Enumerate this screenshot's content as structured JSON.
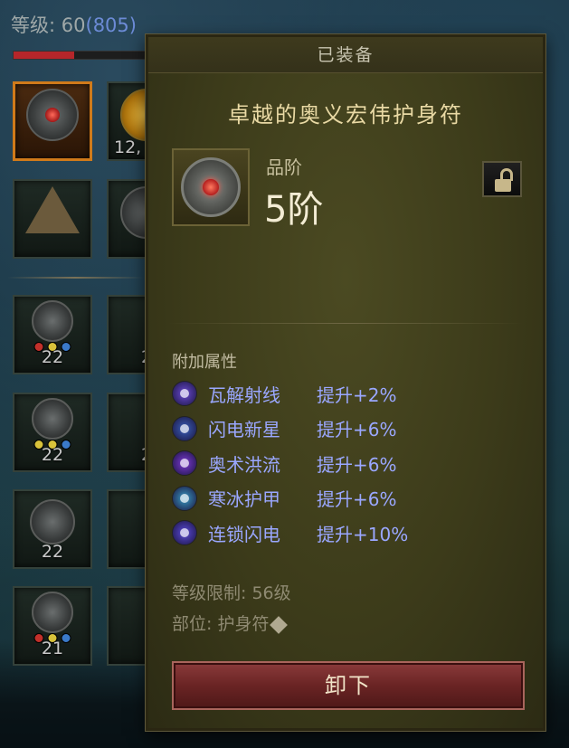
{
  "hud": {
    "level_label": "等级: ",
    "level_value": "60",
    "paragon_value": "(805)",
    "xp_fraction": 0.45
  },
  "inventory": {
    "slots": [
      {
        "count": ""
      },
      {
        "count": "12,"
      },
      {
        "count": ""
      },
      {
        "count": ""
      },
      {
        "count": "22"
      },
      {
        "count": "2"
      },
      {
        "count": "22"
      },
      {
        "count": "2"
      },
      {
        "count": "22"
      },
      {
        "count": ""
      },
      {
        "count": "21"
      },
      {
        "count": ""
      }
    ]
  },
  "tooltip": {
    "header": "已装备",
    "item_name": "卓越的奥义宏伟护身符",
    "grade_label": "品阶",
    "grade_value": "5阶",
    "attributes_title": "附加属性",
    "attributes": [
      {
        "skill": "瓦解射线",
        "bonus": "提升+2%",
        "icon": "disintegrate-icon",
        "color": "#6a4bd2"
      },
      {
        "skill": "闪电新星",
        "bonus": "提升+6%",
        "icon": "lightning-nova-icon",
        "color": "#3a5fb8"
      },
      {
        "skill": "奥术洪流",
        "bonus": "提升+6%",
        "icon": "arcane-torrent-icon",
        "color": "#7b3ad2"
      },
      {
        "skill": "寒冰护甲",
        "bonus": "提升+6%",
        "icon": "ice-armor-icon",
        "color": "#3a9ac2"
      },
      {
        "skill": "连锁闪电",
        "bonus": "提升+10%",
        "icon": "chain-lightning-icon",
        "color": "#5a4ad6"
      }
    ],
    "level_requirement_label": "等级限制:",
    "level_requirement_value": "56级",
    "slot_label": "部位:",
    "slot_value": "护身符",
    "unequip_label": "卸下"
  },
  "colors": {
    "attribute_text": "#9aa7ff",
    "item_name": "#e9d9a4",
    "unequip_button": "#6a2424"
  }
}
